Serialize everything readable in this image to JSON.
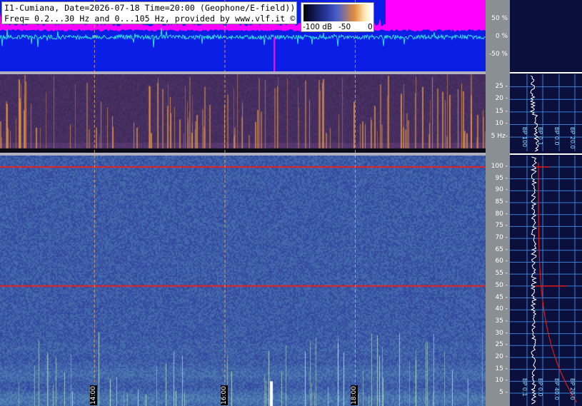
{
  "chart_data": [
    {
      "type": "line",
      "panel": "waveform",
      "ylim": [
        -100,
        100
      ],
      "y_ticks": [
        "50 %",
        "0 %",
        "-50 %"
      ],
      "y_tick_values": [
        50,
        0,
        -50
      ],
      "colors": {
        "background": "#0a1ee6",
        "envelope": "#ff00ff",
        "trace": "#30e0e0",
        "marker": "#ff00ff"
      }
    },
    {
      "type": "heatmap",
      "panel": "low-frequency spectrogram",
      "freq_range_hz": [
        0.2,
        30
      ],
      "y_ticks": [
        "25 -",
        "20 -",
        "15 -",
        "10 -",
        "5 Hz-"
      ],
      "y_tick_values": [
        25,
        20,
        15,
        10,
        5
      ]
    },
    {
      "type": "heatmap",
      "panel": "high-frequency spectrogram",
      "freq_range_hz": [
        0,
        105
      ],
      "y_ticks": [
        "100 -",
        "95 -",
        "90 -",
        "85 -",
        "80 -",
        "75 -",
        "70 -",
        "65 -",
        "60 -",
        "55 -",
        "50 -",
        "45 -",
        "40 -",
        "35 -",
        "30 -",
        "25 -",
        "20 -",
        "15 -",
        "10 -",
        "5 -"
      ],
      "y_tick_values": [
        100,
        95,
        90,
        85,
        80,
        75,
        70,
        65,
        60,
        55,
        50,
        45,
        40,
        35,
        30,
        25,
        20,
        15,
        10,
        5
      ],
      "x_ticks": [
        "14:00",
        "16:00",
        "18:00"
      ],
      "x_tick_hours": [
        14,
        16,
        18
      ],
      "time_range_hours": [
        12.55,
        20.0
      ],
      "line_features_hz": [
        100,
        50
      ]
    }
  ],
  "header": {
    "title_line1": "I1-Cumiana, Date=2026-07-18 Time=20:00 (Geophone/E-field))",
    "title_line2": "Freq= 0.2...30 Hz and 0...105 Hz, provided by www.vlf.it ©"
  },
  "colorbar": {
    "labels": [
      "-100 dB",
      "-50",
      "0"
    ],
    "values_db": [
      -100,
      -50,
      0
    ]
  },
  "side_labels": {
    "top": [
      "BP 100",
      "BP 0.1",
      "BP 0.0",
      "BP 20.0"
    ],
    "bottom": [
      "BP 0.1",
      "BP 0.0",
      "BP 40.0",
      "BP 20.0"
    ]
  },
  "colors": {
    "axis_bar": "#8a8f94",
    "side_bg": "#0a0f3c",
    "grid": "#3a7fcf",
    "red_curve": "#e01818"
  }
}
